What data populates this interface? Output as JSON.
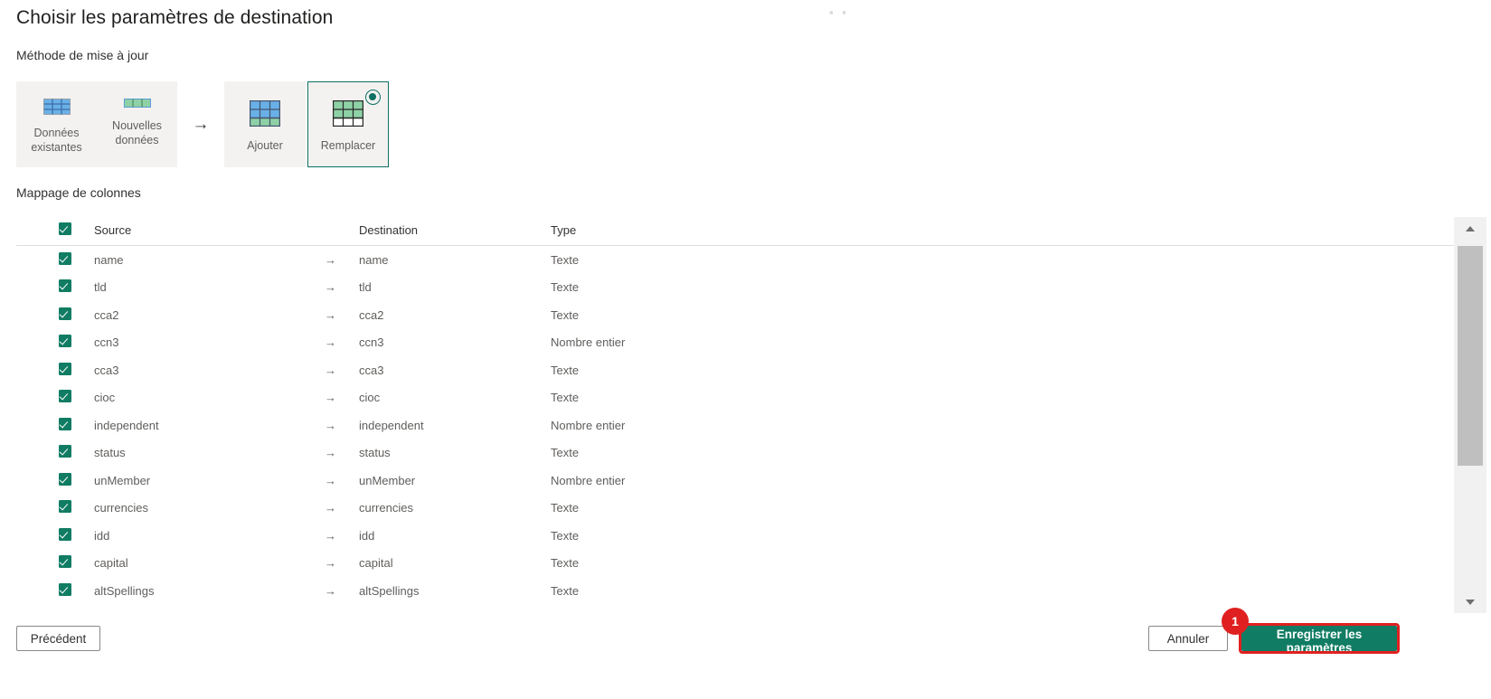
{
  "page": {
    "title": "Choisir les paramètres de destination",
    "top_marks": "▪ ▪"
  },
  "update_method": {
    "label": "Méthode de mise à jour",
    "source_items": [
      {
        "label": "Données existantes",
        "icon": "table-blue-grid-icon"
      },
      {
        "label": "Nouvelles données",
        "icon": "table-green-row-icon"
      }
    ],
    "arrow": "→",
    "options": [
      {
        "label": "Ajouter",
        "icon": "append-table-icon",
        "selected": false
      },
      {
        "label": "Remplacer",
        "icon": "replace-table-icon",
        "selected": true
      }
    ]
  },
  "column_mapping": {
    "label": "Mappage de colonnes",
    "headers": {
      "select_all": "",
      "source": "Source",
      "destination": "Destination",
      "type": "Type"
    },
    "arrow": "→",
    "rows": [
      {
        "checked": true,
        "source": "name",
        "destination": "name",
        "type": "Texte"
      },
      {
        "checked": true,
        "source": "tld",
        "destination": "tld",
        "type": "Texte"
      },
      {
        "checked": true,
        "source": "cca2",
        "destination": "cca2",
        "type": "Texte"
      },
      {
        "checked": true,
        "source": "ccn3",
        "destination": "ccn3",
        "type": "Nombre entier"
      },
      {
        "checked": true,
        "source": "cca3",
        "destination": "cca3",
        "type": "Texte"
      },
      {
        "checked": true,
        "source": "cioc",
        "destination": "cioc",
        "type": "Texte"
      },
      {
        "checked": true,
        "source": "independent",
        "destination": "independent",
        "type": "Nombre entier"
      },
      {
        "checked": true,
        "source": "status",
        "destination": "status",
        "type": "Texte"
      },
      {
        "checked": true,
        "source": "unMember",
        "destination": "unMember",
        "type": "Nombre entier"
      },
      {
        "checked": true,
        "source": "currencies",
        "destination": "currencies",
        "type": "Texte"
      },
      {
        "checked": true,
        "source": "idd",
        "destination": "idd",
        "type": "Texte"
      },
      {
        "checked": true,
        "source": "capital",
        "destination": "capital",
        "type": "Texte"
      },
      {
        "checked": true,
        "source": "altSpellings",
        "destination": "altSpellings",
        "type": "Texte"
      }
    ]
  },
  "scrollbar": {
    "up_icon": "chevron-up-icon",
    "down_icon": "chevron-down-icon"
  },
  "footer": {
    "previous_label": "Précédent",
    "cancel_label": "Annuler",
    "save_label": "Enregistrer les paramètres",
    "step_badge": "1"
  },
  "colors": {
    "accent_green": "#107c63",
    "selected_border": "#0e7060",
    "highlight_red": "#e02020",
    "panel_gray": "#f3f2f1",
    "text_primary": "#323130",
    "text_secondary": "#605e5c"
  }
}
